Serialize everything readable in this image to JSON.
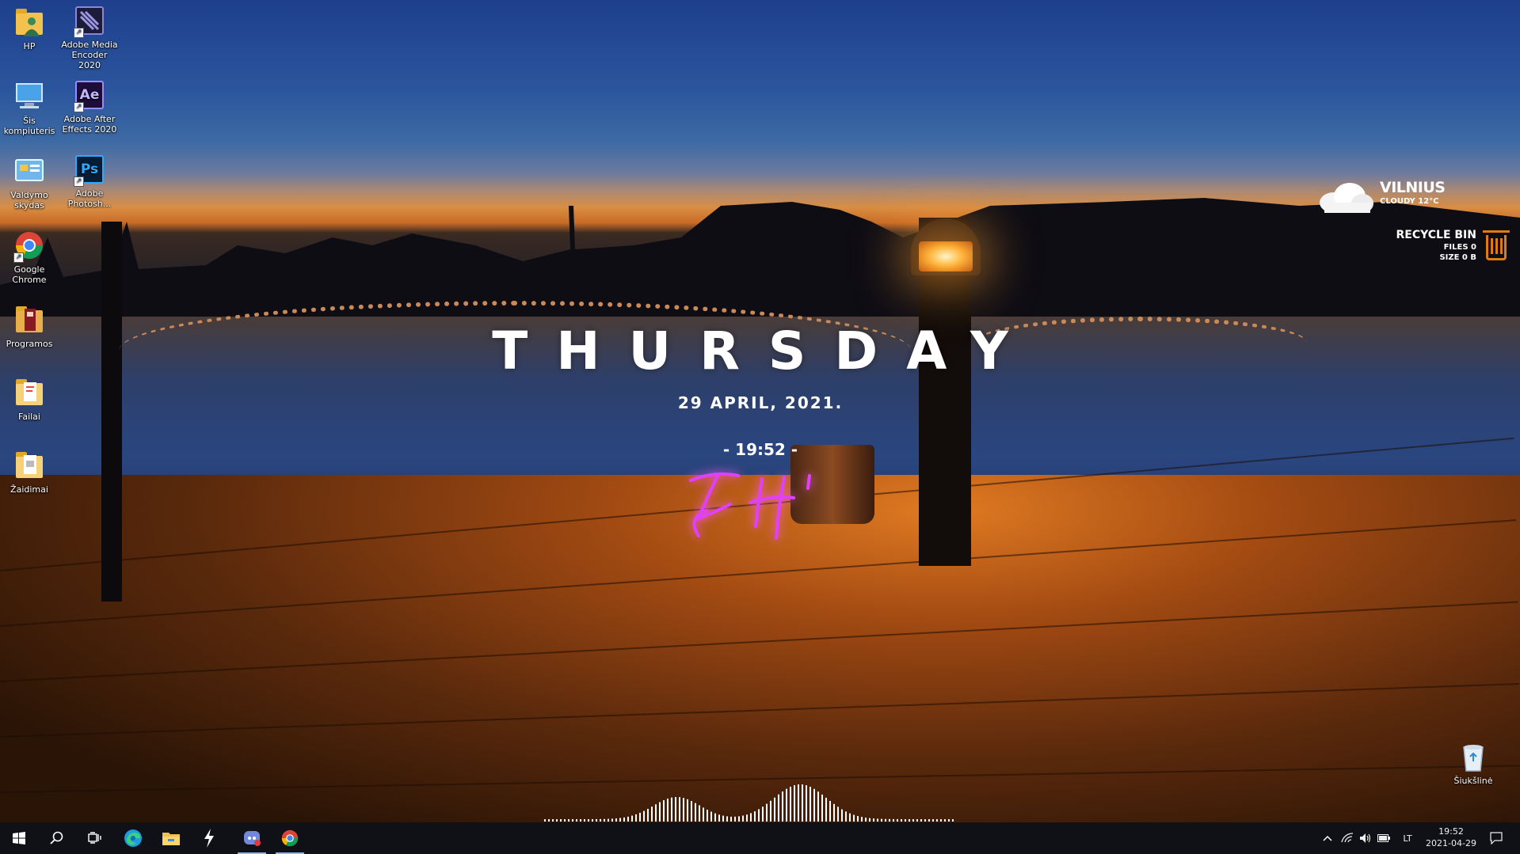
{
  "desktop_icons": [
    {
      "label": "HP",
      "icon": "user-folder-icon"
    },
    {
      "label": "Adobe Media Encoder 2020",
      "icon": "media-encoder-icon"
    },
    {
      "label": "Šis kompiuteris",
      "icon": "this-pc-icon"
    },
    {
      "label": "Adobe After Effects 2020",
      "icon": "after-effects-icon"
    },
    {
      "label": "Valdymo skydas",
      "icon": "control-panel-icon"
    },
    {
      "label": "Adobe Photosh...",
      "icon": "photoshop-icon"
    },
    {
      "label": "Google Chrome",
      "icon": "chrome-icon"
    },
    {
      "label": "Programos",
      "icon": "folder-icon"
    },
    {
      "label": "Failai",
      "icon": "folder-icon"
    },
    {
      "label": "Žaidimai",
      "icon": "folder-icon"
    },
    {
      "label": "Šiukšlinė",
      "icon": "recycle-bin-icon"
    }
  ],
  "app_glyphs": {
    "after_effects": "Ae",
    "photoshop": "Ps"
  },
  "widgets": {
    "day": "THURSDAY",
    "date": "29 APRIL, 2021.",
    "time": "- 19:52 -",
    "weather": {
      "city": "VILNIUS",
      "condition": "CLOUDY 12°C"
    },
    "recycle": {
      "title": "RECYCLE BIN",
      "files": "FILES 0",
      "size": "SIZE 0 B"
    }
  },
  "taskbar": {
    "apps": [
      "start-icon",
      "search-icon",
      "task-view-icon",
      "edge-icon",
      "file-explorer-icon",
      "winamp-icon",
      "discord-icon",
      "chrome-icon"
    ],
    "tray": {
      "language": "LT",
      "time": "19:52",
      "date": "2021-04-29"
    }
  },
  "colors": {
    "accent_orange": "#e07b10",
    "neon_pink": "#e040fb",
    "taskbar": "#101014"
  }
}
